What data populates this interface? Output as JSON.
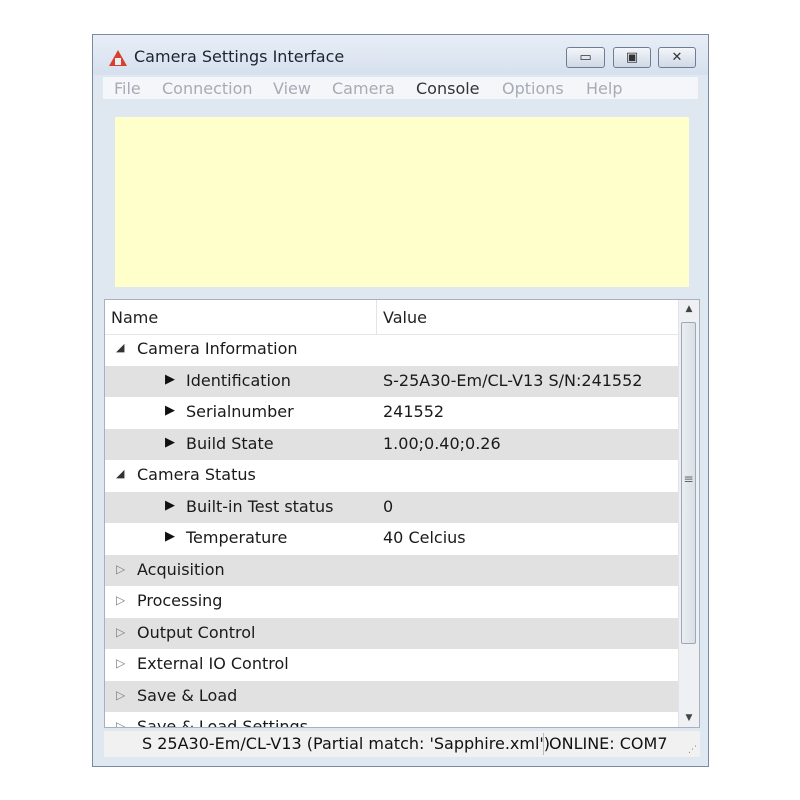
{
  "window": {
    "title": "Camera Settings Interface",
    "icon": "red-triangle-logo-icon",
    "controls": {
      "minimize": "▭",
      "maximize": "▣",
      "close": "✕"
    }
  },
  "menu": [
    {
      "label": "File",
      "enabled": false
    },
    {
      "label": "Connection",
      "enabled": false
    },
    {
      "label": "View",
      "enabled": false
    },
    {
      "label": "Camera",
      "enabled": false
    },
    {
      "label": "Console",
      "enabled": true
    },
    {
      "label": "Options",
      "enabled": false
    },
    {
      "label": "Help",
      "enabled": false
    }
  ],
  "console_color": "#ffffcc",
  "tree": {
    "headers": {
      "name": "Name",
      "value": "Value"
    },
    "rows": [
      {
        "name": "Camera Information",
        "value": "",
        "level": 0,
        "expanded": true,
        "marker": "◢"
      },
      {
        "name": "Identification",
        "value": "S-25A30-Em/CL-V13 S/N:241552",
        "level": 1,
        "marker": "▶"
      },
      {
        "name": "Serialnumber",
        "value": "241552",
        "level": 1,
        "marker": "▶"
      },
      {
        "name": "Build State",
        "value": "1.00;0.40;0.26",
        "level": 1,
        "marker": "▶"
      },
      {
        "name": "Camera Status",
        "value": "",
        "level": 0,
        "expanded": true,
        "marker": "◢"
      },
      {
        "name": "Built-in Test status",
        "value": "0",
        "level": 1,
        "marker": "▶"
      },
      {
        "name": "Temperature",
        "value": "40 Celcius",
        "level": 1,
        "marker": "▶"
      },
      {
        "name": "Acquisition",
        "value": "",
        "level": 0,
        "expanded": false,
        "marker": "▷"
      },
      {
        "name": "Processing",
        "value": "",
        "level": 0,
        "expanded": false,
        "marker": "▷"
      },
      {
        "name": "Output Control",
        "value": "",
        "level": 0,
        "expanded": false,
        "marker": "▷"
      },
      {
        "name": "External IO Control",
        "value": "",
        "level": 0,
        "expanded": false,
        "marker": "▷"
      },
      {
        "name": "Save & Load",
        "value": "",
        "level": 0,
        "expanded": false,
        "marker": "▷"
      },
      {
        "name": "Save & Load Settings",
        "value": "",
        "level": 0,
        "expanded": false,
        "marker": "▷"
      }
    ],
    "scrollbar": {
      "up": "▲",
      "down": "▼",
      "grip": "≡"
    }
  },
  "status": {
    "text": "S 25A30-Em/CL-V13 (Partial match: 'Sapphire.xml')",
    "online": "ONLINE: COM7"
  }
}
